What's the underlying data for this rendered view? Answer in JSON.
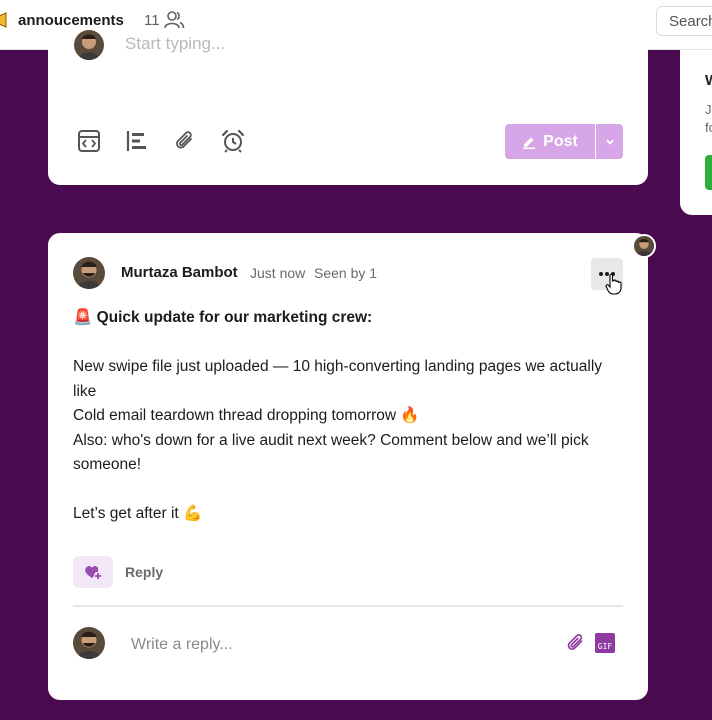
{
  "header": {
    "channel_name": "annoucements",
    "member_count": "11",
    "search_placeholder": "Search"
  },
  "composer": {
    "placeholder": "Start typing...",
    "tools": [
      "code-block-icon",
      "align-left-icon",
      "paperclip-icon",
      "alarm-clock-icon"
    ],
    "post_label": "Post"
  },
  "side_panel": {
    "title": "W",
    "line1": "J",
    "line2": "fo"
  },
  "post": {
    "author": "Murtaza Bambot",
    "time": "Just now",
    "seen": "Seen by 1",
    "lines": [
      "🚨 Quick update for our marketing crew:",
      "",
      "New swipe file just uploaded — 10 high-converting landing pages we actually like",
      "Cold email teardown thread dropping tomorrow 🔥",
      "Also: who's down for a live audit next week? Comment below and we’ll pick someone!",
      "",
      "Let’s get after it 💪"
    ],
    "reply_label": "Reply",
    "reply_placeholder": "Write a reply...",
    "gif_label": "GIF"
  },
  "colors": {
    "background": "#4a0a4f",
    "post_button": "#d6a6e6",
    "gif_badge": "#8e3aa0"
  }
}
